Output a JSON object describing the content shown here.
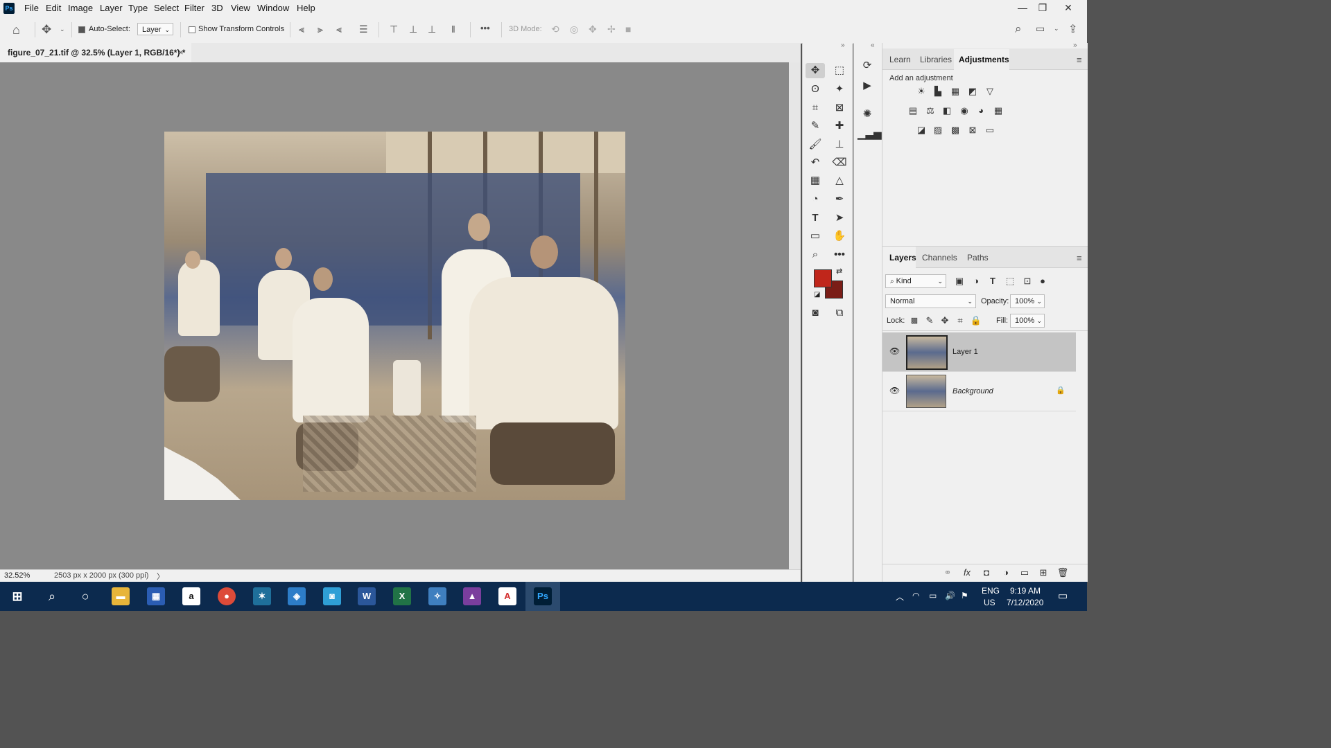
{
  "app": {
    "logo": "Ps"
  },
  "menu": [
    "File",
    "Edit",
    "Image",
    "Layer",
    "Type",
    "Select",
    "Filter",
    "3D",
    "View",
    "Window",
    "Help"
  ],
  "window_controls": {
    "minimize": "—",
    "restore": "❐",
    "close": "✕"
  },
  "options": {
    "auto_select_label": "Auto-Select:",
    "auto_select_value": "Layer",
    "show_transform_label": "Show Transform Controls",
    "mode3d_label": "3D Mode:",
    "more": "•••"
  },
  "document": {
    "tab_title": "figure_07_21.tif @ 32.5% (Layer 1, RGB/16*) *",
    "close": "×"
  },
  "status": {
    "zoom": "32.52%",
    "info": "2503 px x 2000 px (300 ppi)",
    "arrow": "〉"
  },
  "colors": {
    "foreground": "#c0261b",
    "background": "#7a1d17"
  },
  "panels": {
    "top_tabs": [
      "Learn",
      "Libraries",
      "Adjustments"
    ],
    "active_top": "Adjustments",
    "add_adjustment": "Add an adjustment",
    "layer_tabs": [
      "Layers",
      "Channels",
      "Paths"
    ],
    "active_layer_tab": "Layers",
    "kind_label": "Kind",
    "blend_mode": "Normal",
    "opacity_label": "Opacity:",
    "opacity_value": "100%",
    "lock_label": "Lock:",
    "fill_label": "Fill:",
    "fill_value": "100%",
    "menu_icon": "≡"
  },
  "layers": [
    {
      "name": "Layer 1",
      "selected": true,
      "locked": false
    },
    {
      "name": "Background",
      "selected": false,
      "locked": true
    }
  ],
  "layer_footer_icons": [
    "link-icon",
    "fx-icon",
    "mask-icon",
    "adjustment-icon",
    "group-icon",
    "new-layer-icon",
    "trash-icon"
  ],
  "fx_label": "fx",
  "taskbar": {
    "lang": "ENG",
    "region": "US",
    "time": "9:19 AM",
    "date": "7/12/2020"
  }
}
